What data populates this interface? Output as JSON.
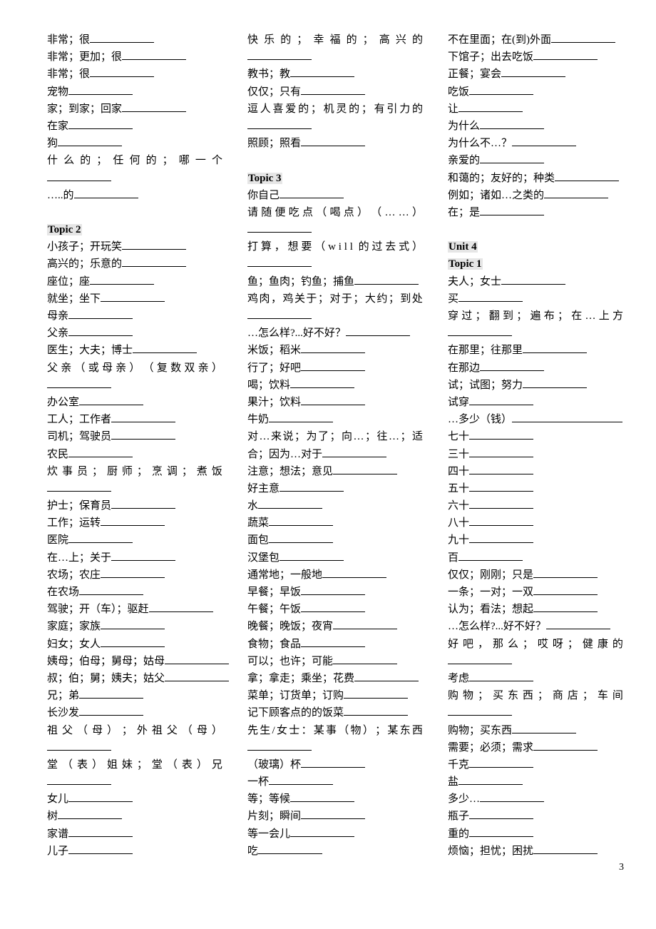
{
  "page_number": "3",
  "columns": [
    [
      {
        "t": "item",
        "text": "非常；很"
      },
      {
        "t": "item",
        "text": "非常；更加；很"
      },
      {
        "t": "item",
        "text": "非常；很"
      },
      {
        "t": "item",
        "text": "宠物"
      },
      {
        "t": "item",
        "text": "家；到家；回家"
      },
      {
        "t": "item",
        "text": "在家"
      },
      {
        "t": "item",
        "text": "狗"
      },
      {
        "t": "wrap",
        "text": "什么的；任何的；哪一个"
      },
      {
        "t": "item",
        "text": "…..的"
      },
      {
        "t": "gap"
      },
      {
        "t": "head",
        "text": "Topic 2"
      },
      {
        "t": "item",
        "text": "小孩子；开玩笑"
      },
      {
        "t": "item",
        "text": "高兴的；乐意的"
      },
      {
        "t": "item",
        "text": "座位；座"
      },
      {
        "t": "item",
        "text": "就坐；坐下"
      },
      {
        "t": "item",
        "text": "母亲"
      },
      {
        "t": "item",
        "text": "父亲"
      },
      {
        "t": "item",
        "text": "医生；大夫；博士"
      },
      {
        "t": "wrap",
        "text": "父亲（或母亲）（复数双亲）"
      },
      {
        "t": "item",
        "text": "办公室"
      },
      {
        "t": "item",
        "text": "工人；工作者"
      },
      {
        "t": "item",
        "text": "司机；驾驶员"
      },
      {
        "t": "item",
        "text": "农民"
      },
      {
        "t": "wrap",
        "text": "炊事员；厨师；烹调；煮饭"
      },
      {
        "t": "item",
        "text": "护士；保育员"
      },
      {
        "t": "item",
        "text": "工作；运转"
      },
      {
        "t": "item",
        "text": "医院"
      },
      {
        "t": "item",
        "text": "在…上；关于"
      },
      {
        "t": "item",
        "text": "农场；农庄"
      },
      {
        "t": "item",
        "text": "在农场"
      },
      {
        "t": "item",
        "text": "驾驶；开（车）；驱赶"
      },
      {
        "t": "item",
        "text": "家庭；家族"
      },
      {
        "t": "item",
        "text": "妇女；女人"
      },
      {
        "t": "item",
        "text": "姨母；伯母；舅母；姑母"
      },
      {
        "t": "item",
        "text": "叔；伯；舅；姨夫；姑父"
      },
      {
        "t": "item",
        "text": "兄；弟"
      },
      {
        "t": "item",
        "text": "长沙发"
      },
      {
        "t": "wrap",
        "text": "祖父（母）；外祖父（母）"
      },
      {
        "t": "wrap",
        "text": "堂（表）姐妹；堂（表）兄"
      },
      {
        "t": "item",
        "text": "女儿"
      },
      {
        "t": "item",
        "text": "树"
      },
      {
        "t": "item",
        "text": "家谱"
      },
      {
        "t": "item",
        "text": "儿子"
      }
    ],
    [
      {
        "t": "wrap",
        "text": "快乐的；幸福的；高兴的"
      },
      {
        "t": "item",
        "text": "教书；教"
      },
      {
        "t": "item",
        "text": "仅仅；只有"
      },
      {
        "t": "wrap",
        "text": "逗人喜爱的；机灵的；有引力的"
      },
      {
        "t": "item",
        "text": "照顾；照看"
      },
      {
        "t": "gap"
      },
      {
        "t": "head",
        "text": "Topic 3"
      },
      {
        "t": "item",
        "text": "你自己"
      },
      {
        "t": "wrap",
        "text": "请随便吃点（喝点）（……）"
      },
      {
        "t": "wrap",
        "text": "打算，想要（will 的过去式）"
      },
      {
        "t": "item",
        "text": "鱼；鱼肉；钓鱼；捕鱼"
      },
      {
        "t": "wrap",
        "text": "鸡肉，鸡关于；对于；大约；到处"
      },
      {
        "t": "item",
        "text": "…怎么样?...好不好？"
      },
      {
        "t": "item",
        "text": "米饭；稻米"
      },
      {
        "t": "item",
        "text": "行了；好吧"
      },
      {
        "t": "item",
        "text": "喝；饮料"
      },
      {
        "t": "item",
        "text": "果汁；饮料"
      },
      {
        "t": "item",
        "text": "牛奶"
      },
      {
        "t": "plain",
        "text": "对…来说；为了；向…；往…；适"
      },
      {
        "t": "item",
        "text": "合；因为…对于"
      },
      {
        "t": "item",
        "text": "注意；想法；意见"
      },
      {
        "t": "item",
        "text": "好主意"
      },
      {
        "t": "item",
        "text": "水"
      },
      {
        "t": "item",
        "text": "蔬菜"
      },
      {
        "t": "item",
        "text": "面包"
      },
      {
        "t": "item",
        "text": "汉堡包"
      },
      {
        "t": "item",
        "text": "通常地；一般地"
      },
      {
        "t": "item",
        "text": "早餐；早饭"
      },
      {
        "t": "item",
        "text": "午餐；午饭"
      },
      {
        "t": "item",
        "text": "晚餐；晚饭；夜宵"
      },
      {
        "t": "item",
        "text": "食物；食品"
      },
      {
        "t": "item",
        "text": "可以；也许；可能"
      },
      {
        "t": "item",
        "text": "拿；拿走；乘坐；花费"
      },
      {
        "t": "item",
        "text": "菜单；订货单；订购"
      },
      {
        "t": "item",
        "text": "记下顾客点的的饭菜"
      },
      {
        "t": "wrap",
        "text": "先生/女士：某事（物）；某东西"
      },
      {
        "t": "item",
        "text": "（玻璃）杯"
      },
      {
        "t": "item",
        "text": "一杯"
      },
      {
        "t": "item",
        "text": "等；等候"
      },
      {
        "t": "item",
        "text": "片刻；瞬间"
      },
      {
        "t": "item",
        "text": "等一会儿"
      },
      {
        "t": "item",
        "text": "吃"
      }
    ],
    [
      {
        "t": "item",
        "text": "不在里面；在(到)外面"
      },
      {
        "t": "item",
        "text": "下馆子；出去吃饭"
      },
      {
        "t": "item",
        "text": "正餐；宴会"
      },
      {
        "t": "item",
        "text": "吃饭"
      },
      {
        "t": "item",
        "text": "让"
      },
      {
        "t": "item",
        "text": "为什么"
      },
      {
        "t": "item",
        "text": "为什么不…？"
      },
      {
        "t": "item",
        "text": "亲爱的"
      },
      {
        "t": "item",
        "text": "和蔼的；友好的；种类"
      },
      {
        "t": "item",
        "text": "例如；诸如…之类的"
      },
      {
        "t": "item",
        "text": "在；是"
      },
      {
        "t": "gap"
      },
      {
        "t": "head",
        "text": "Unit 4"
      },
      {
        "t": "head",
        "text": "Topic 1"
      },
      {
        "t": "item",
        "text": "夫人；女士"
      },
      {
        "t": "item",
        "text": "买"
      },
      {
        "t": "wrap",
        "text": "穿过；翻到；遍布；在…上方"
      },
      {
        "t": "item",
        "text": "在那里；往那里"
      },
      {
        "t": "item",
        "text": "在那边"
      },
      {
        "t": "item",
        "text": "试；试图；努力"
      },
      {
        "t": "item",
        "text": "试穿"
      },
      {
        "t": "item",
        "text": "…多少（钱）",
        "wide": true
      },
      {
        "t": "item",
        "text": "七十"
      },
      {
        "t": "item",
        "text": "三十"
      },
      {
        "t": "item",
        "text": "四十"
      },
      {
        "t": "item",
        "text": "五十"
      },
      {
        "t": "item",
        "text": "六十"
      },
      {
        "t": "item",
        "text": "八十"
      },
      {
        "t": "item",
        "text": "九十"
      },
      {
        "t": "item",
        "text": "百"
      },
      {
        "t": "item",
        "text": "仅仅；刚刚；只是"
      },
      {
        "t": "item",
        "text": "一条；一对；一双"
      },
      {
        "t": "item",
        "text": "认为；看法；想起"
      },
      {
        "t": "item",
        "text": "…怎么样?...好不好？"
      },
      {
        "t": "wrap",
        "text": "好吧，那么；哎呀；健康的"
      },
      {
        "t": "item",
        "text": "考虑"
      },
      {
        "t": "wrap",
        "text": "购物；买东西；商店；车间"
      },
      {
        "t": "item",
        "text": "购物；买东西"
      },
      {
        "t": "item",
        "text": "需要；必须；需求"
      },
      {
        "t": "item",
        "text": "千克"
      },
      {
        "t": "item",
        "text": "盐"
      },
      {
        "t": "item",
        "text": "多少…"
      },
      {
        "t": "item",
        "text": "瓶子"
      },
      {
        "t": "item",
        "text": "重的"
      },
      {
        "t": "item",
        "text": "烦恼；担忧；困扰"
      }
    ]
  ]
}
